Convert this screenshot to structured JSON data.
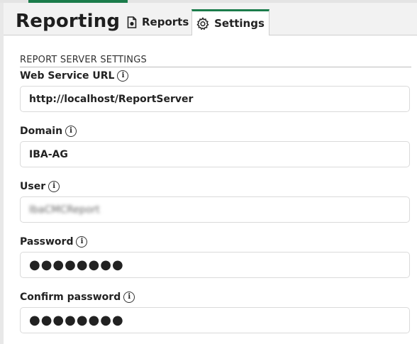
{
  "header": {
    "title": "Reporting",
    "tabs": [
      {
        "label": "Reports",
        "icon": "report-document-icon"
      },
      {
        "label": "Settings",
        "icon": "gear-icon",
        "active": true
      }
    ]
  },
  "section": {
    "title": "REPORT SERVER SETTINGS"
  },
  "fields": {
    "web_service_url": {
      "label": "Web Service URL",
      "value": "http://localhost/ReportServer"
    },
    "domain": {
      "label": "Domain",
      "value": "IBA-AG"
    },
    "user": {
      "label": "User",
      "value": "IbaCMCReport"
    },
    "password": {
      "label": "Password",
      "value": "●●●●●●●●"
    },
    "confirm_password": {
      "label": "Confirm password",
      "value": "●●●●●●●●"
    }
  },
  "info_glyph": "i",
  "colors": {
    "accent": "#1b7c4b",
    "header_bg": "#f2f2f2"
  }
}
